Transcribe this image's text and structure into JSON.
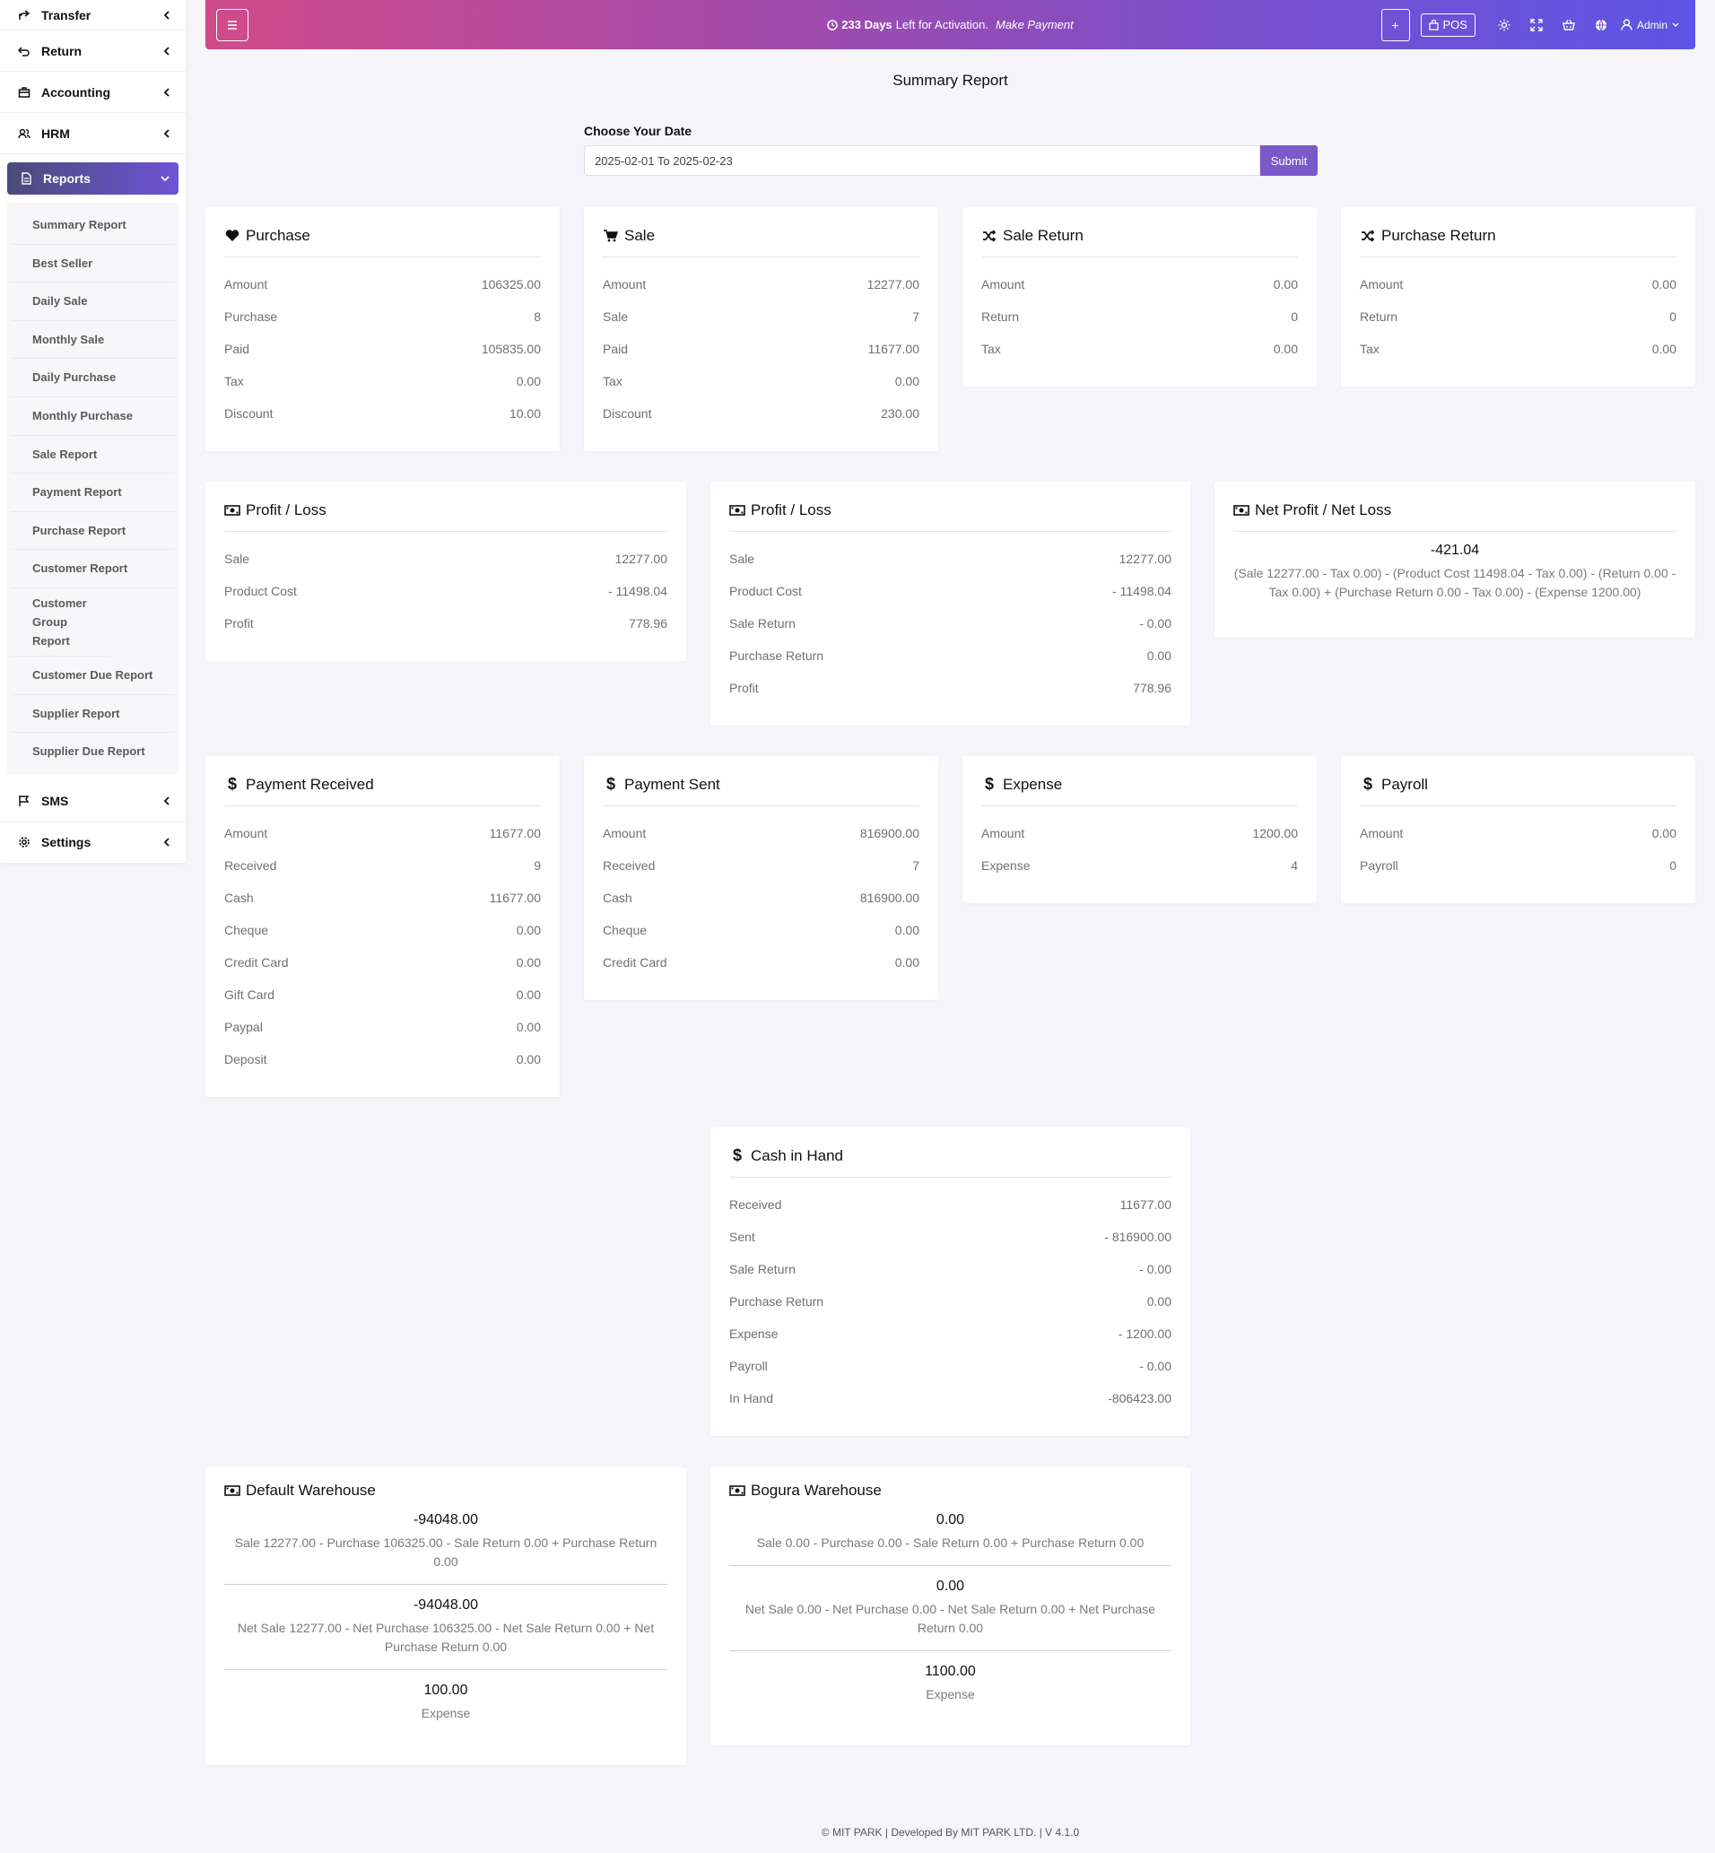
{
  "sidebar": {
    "items_top": [
      {
        "label": "Transfer",
        "icon": "share-icon"
      },
      {
        "label": "Return",
        "icon": "return-icon"
      },
      {
        "label": "Accounting",
        "icon": "briefcase-icon"
      },
      {
        "label": "HRM",
        "icon": "users-icon"
      }
    ],
    "active": {
      "label": "Reports",
      "icon": "file-icon"
    },
    "submenu": [
      "Summary Report",
      "Best Seller",
      "Daily Sale",
      "Monthly Sale",
      "Daily Purchase",
      "Monthly Purchase",
      "Sale Report",
      "Payment Report",
      "Purchase Report",
      "Customer Report",
      "Customer Group Report",
      "Customer Due Report",
      "Supplier Report",
      "Supplier Due Report"
    ],
    "items_bottom": [
      {
        "label": "SMS",
        "icon": "flag-icon"
      },
      {
        "label": "Settings",
        "icon": "gear-icon"
      }
    ]
  },
  "topbar": {
    "days": "233 Days",
    "activation_text": "Left for Activation.",
    "make_payment": "Make Payment",
    "plus": "+",
    "pos": "POS",
    "admin": "Admin"
  },
  "page": {
    "title": "Summary Report",
    "date_label": "Choose Your Date",
    "date_value": "2025-02-01 To 2025-02-23",
    "submit": "Submit"
  },
  "cards": {
    "purchase": {
      "title": "Purchase",
      "rows": [
        [
          "Amount",
          "106325.00"
        ],
        [
          "Purchase",
          "8"
        ],
        [
          "Paid",
          "105835.00"
        ],
        [
          "Tax",
          "0.00"
        ],
        [
          "Discount",
          "10.00"
        ]
      ]
    },
    "sale": {
      "title": "Sale",
      "rows": [
        [
          "Amount",
          "12277.00"
        ],
        [
          "Sale",
          "7"
        ],
        [
          "Paid",
          "11677.00"
        ],
        [
          "Tax",
          "0.00"
        ],
        [
          "Discount",
          "230.00"
        ]
      ]
    },
    "sale_return": {
      "title": "Sale Return",
      "rows": [
        [
          "Amount",
          "0.00"
        ],
        [
          "Return",
          "0"
        ],
        [
          "Tax",
          "0.00"
        ]
      ]
    },
    "purchase_return": {
      "title": "Purchase Return",
      "rows": [
        [
          "Amount",
          "0.00"
        ],
        [
          "Return",
          "0"
        ],
        [
          "Tax",
          "0.00"
        ]
      ]
    },
    "profit_loss_1": {
      "title": "Profit / Loss",
      "rows": [
        [
          "Sale",
          "12277.00"
        ],
        [
          "Product Cost",
          "- 11498.04"
        ],
        [
          "Profit",
          "778.96"
        ]
      ]
    },
    "profit_loss_2": {
      "title": "Profit / Loss",
      "rows": [
        [
          "Sale",
          "12277.00"
        ],
        [
          "Product Cost",
          "- 11498.04"
        ],
        [
          "Sale Return",
          "- 0.00"
        ],
        [
          "Purchase Return",
          "0.00"
        ],
        [
          "Profit",
          "778.96"
        ]
      ]
    },
    "net_profit": {
      "title": "Net Profit / Net Loss",
      "value": "-421.04",
      "desc": "(Sale 12277.00 - Tax 0.00) - (Product Cost 11498.04 - Tax 0.00) - (Return 0.00 - Tax 0.00) + (Purchase Return 0.00 - Tax 0.00) - (Expense 1200.00)"
    },
    "payment_received": {
      "title": "Payment Received",
      "rows": [
        [
          "Amount",
          "11677.00"
        ],
        [
          "Received",
          "9"
        ],
        [
          "Cash",
          "11677.00"
        ],
        [
          "Cheque",
          "0.00"
        ],
        [
          "Credit Card",
          "0.00"
        ],
        [
          "Gift Card",
          "0.00"
        ],
        [
          "Paypal",
          "0.00"
        ],
        [
          "Deposit",
          "0.00"
        ]
      ]
    },
    "payment_sent": {
      "title": "Payment Sent",
      "rows": [
        [
          "Amount",
          "816900.00"
        ],
        [
          "Received",
          "7"
        ],
        [
          "Cash",
          "816900.00"
        ],
        [
          "Cheque",
          "0.00"
        ],
        [
          "Credit Card",
          "0.00"
        ]
      ]
    },
    "expense": {
      "title": "Expense",
      "rows": [
        [
          "Amount",
          "1200.00"
        ],
        [
          "Expense",
          "4"
        ]
      ]
    },
    "payroll": {
      "title": "Payroll",
      "rows": [
        [
          "Amount",
          "0.00"
        ],
        [
          "Payroll",
          "0"
        ]
      ]
    },
    "cash_in_hand": {
      "title": "Cash in Hand",
      "rows": [
        [
          "Received",
          "11677.00"
        ],
        [
          "Sent",
          "- 816900.00"
        ],
        [
          "Sale Return",
          "- 0.00"
        ],
        [
          "Purchase Return",
          "0.00"
        ],
        [
          "Expense",
          "- 1200.00"
        ],
        [
          "Payroll",
          "- 0.00"
        ],
        [
          "In Hand",
          "-806423.00"
        ]
      ]
    },
    "default_warehouse": {
      "title": "Default Warehouse",
      "blocks": [
        {
          "value": "-94048.00",
          "desc": "Sale 12277.00 - Purchase 106325.00 - Sale Return 0.00 + Purchase Return 0.00"
        },
        {
          "value": "-94048.00",
          "desc": "Net Sale 12277.00 - Net Purchase 106325.00 - Net Sale Return 0.00 + Net Purchase Return 0.00"
        },
        {
          "value": "100.00",
          "desc": "Expense"
        }
      ]
    },
    "bogura_warehouse": {
      "title": "Bogura Warehouse",
      "blocks": [
        {
          "value": "0.00",
          "desc": "Sale 0.00 - Purchase 0.00 - Sale Return 0.00 + Purchase Return 0.00"
        },
        {
          "value": "0.00",
          "desc": "Net Sale 0.00 - Net Purchase 0.00 - Net Sale Return 0.00 + Net Purchase Return 0.00"
        },
        {
          "value": "1100.00",
          "desc": "Expense"
        }
      ]
    }
  },
  "footer": "© MIT PARK | Developed By MIT PARK LTD. | V 4.1.0",
  "colors": {
    "accent": "#7a59c9",
    "gradient_start": "#d04a8a",
    "gradient_end": "#5c55e5"
  }
}
